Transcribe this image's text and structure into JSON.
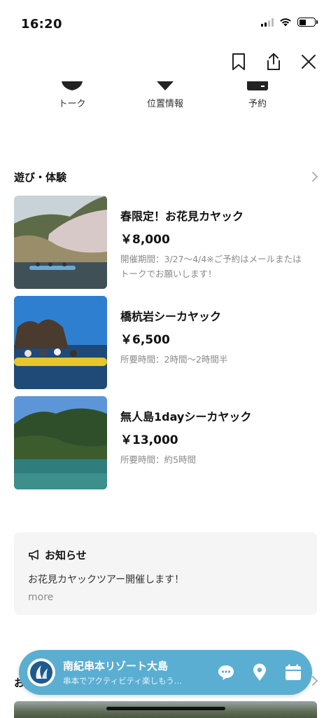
{
  "status_bar": {
    "time": "16:20"
  },
  "quick_tabs": [
    {
      "label": "トーク",
      "icon": "talk-icon"
    },
    {
      "label": "位置情報",
      "icon": "location-icon"
    },
    {
      "label": "予約",
      "icon": "calendar-icon"
    }
  ],
  "activities_section": {
    "title": "遊び・体験",
    "items": [
      {
        "title": "春限定！お花見カヤック",
        "price": "￥8,000",
        "description": "開催期間：3/27〜4/4※ご予約はメールまたはトークでお願いします！"
      },
      {
        "title": "橋杭岩シーカヤック",
        "price": "￥6,500",
        "description": "所要時間：2時間〜2時間半"
      },
      {
        "title": "無人島1dayシーカヤック",
        "price": "￥13,000",
        "description": "所要時間：約5時間"
      }
    ]
  },
  "notice": {
    "title": "お知らせ",
    "text": "お花見カヤックツアー開催します！",
    "more_label": "more"
  },
  "next_section_peek": {
    "title": "お"
  },
  "account_bar": {
    "name": "南紀串本リゾート大島",
    "subtitle": "串本でアクティビティ楽しもう…",
    "color": "#5aaed2"
  }
}
